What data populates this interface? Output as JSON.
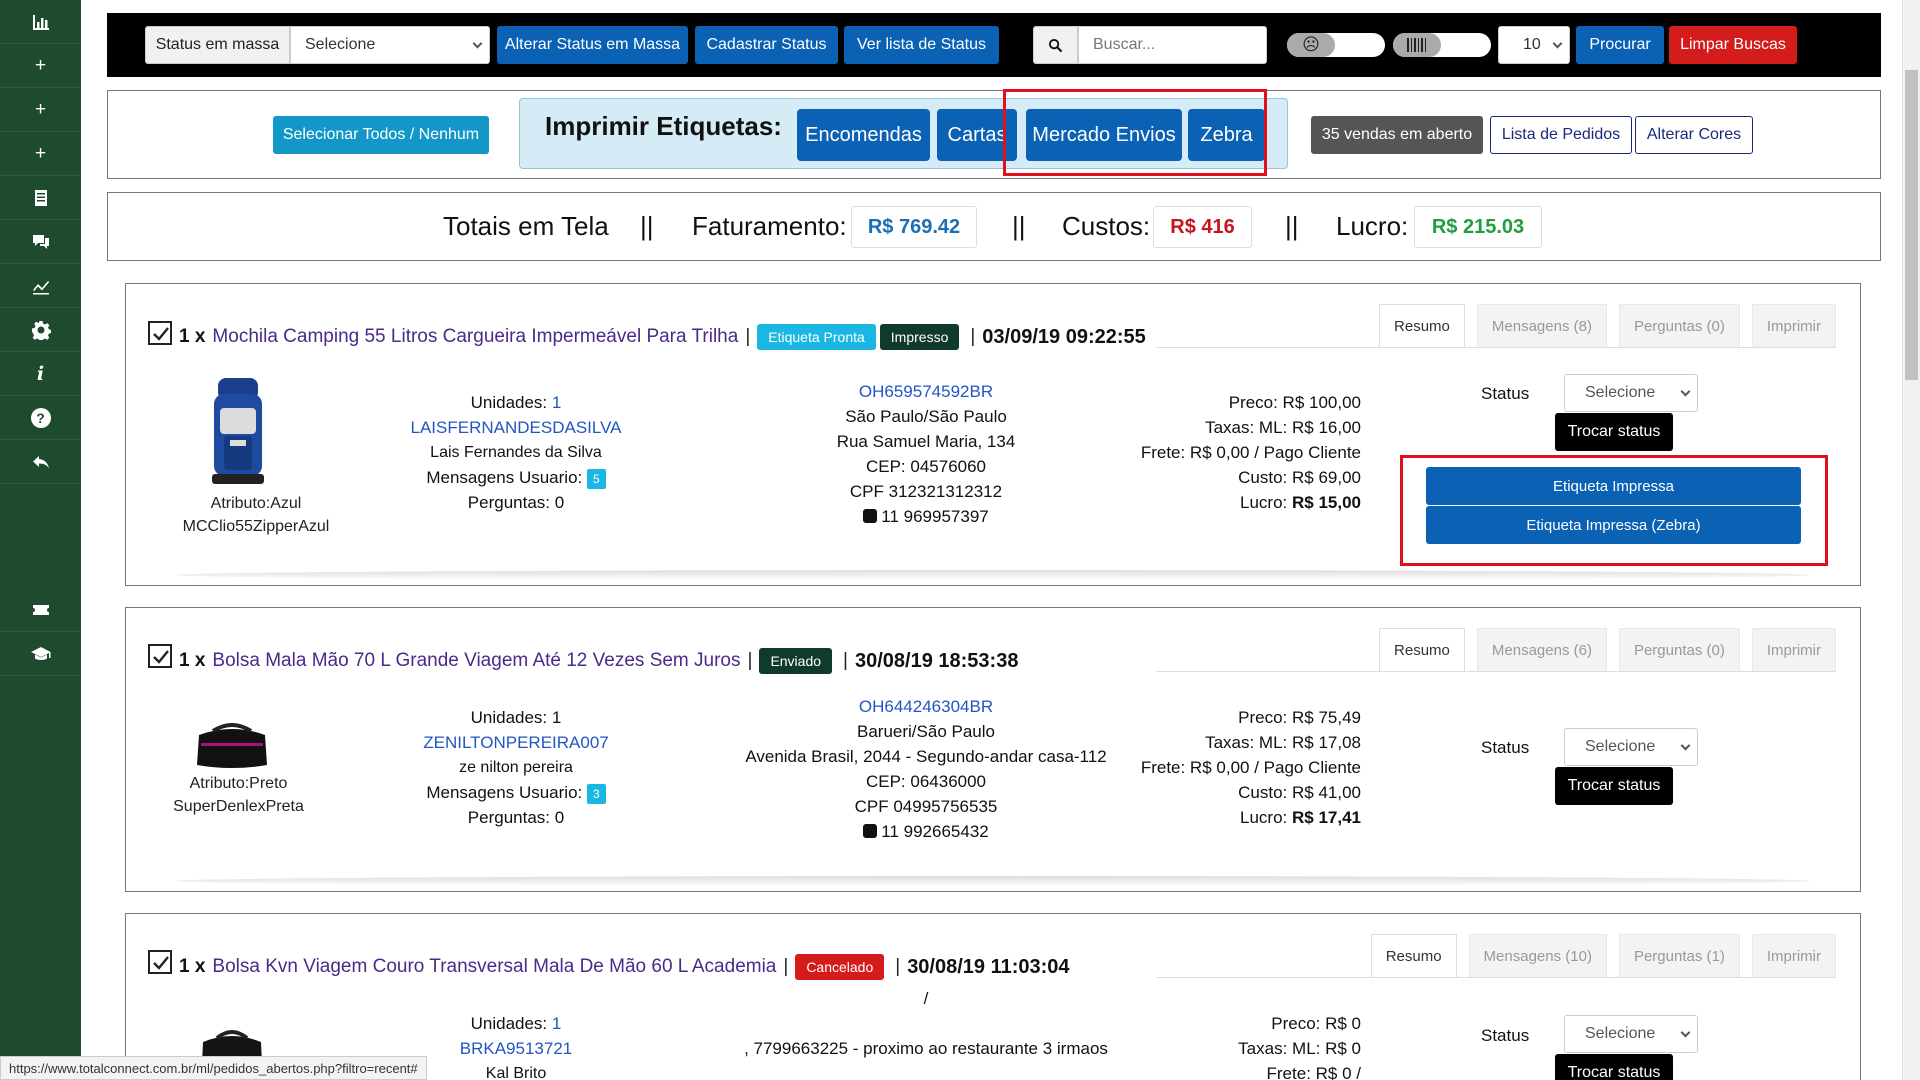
{
  "sidebar": {
    "items": [
      {
        "icon": "bar-chart-icon"
      },
      {
        "icon": "plus-icon",
        "glyph": "+"
      },
      {
        "icon": "plus-icon",
        "glyph": "+"
      },
      {
        "icon": "plus-icon",
        "glyph": "+"
      },
      {
        "icon": "document-icon"
      },
      {
        "icon": "comments-icon"
      },
      {
        "icon": "line-chart-icon"
      },
      {
        "icon": "gear-icon"
      },
      {
        "icon": "info-icon",
        "glyph": "i"
      },
      {
        "icon": "question-icon",
        "glyph": "?"
      },
      {
        "icon": "reply-icon"
      }
    ],
    "lower_items": [
      {
        "icon": "ticket-icon"
      },
      {
        "icon": "graduation-cap-icon"
      }
    ]
  },
  "toolbar": {
    "status_mass_label": "Status em massa",
    "select_value": "Selecione",
    "alter_status_mass": "Alterar Status em Massa",
    "register_status": "Cadastrar Status",
    "view_status_list": "Ver lista de Status",
    "search_placeholder": "Buscar...",
    "page_size": "10",
    "search_button": "Procurar",
    "clear_button": "Limpar Buscas"
  },
  "printbar": {
    "select_all": "Selecionar Todos / Nenhum",
    "print_labels_title": "Imprimir Etiquetas:",
    "print_buttons": [
      "Encomendas",
      "Cartas",
      "Mercado Envios",
      "Zebra"
    ],
    "open_sales": "35 vendas em aberto",
    "order_list": "Lista de Pedidos",
    "alter_colors": "Alterar Cores"
  },
  "totals": {
    "label": "Totais em Tela",
    "sep": "||",
    "revenue_label": "Faturamento:",
    "revenue_value": "R$ 769.42",
    "costs_label": "Custos:",
    "costs_value": "R$ 416",
    "profit_label": "Lucro:",
    "profit_value": "R$ 215.03"
  },
  "colors": {
    "sidebar": "#1e4a2e",
    "primary": "#0b61b3",
    "danger": "#d41c1c",
    "revenue": "#1a6fb5",
    "cost": "#c4161c",
    "profit": "#1e9e3e",
    "highlight": "#e0101c"
  },
  "tabs": {
    "summary": "Resumo",
    "print": "Imprimir"
  },
  "orders": [
    {
      "qty": "1 x",
      "product": "Mochila Camping 55 Litros Cargueira Impermeável Para Trilha",
      "badges": [
        "Etiqueta Pronta",
        "Impresso"
      ],
      "date": "03/09/19 09:22:55",
      "tab_messages": "Mensagens (8)",
      "tab_questions": "Perguntas (0)",
      "attr1": "Atributo:Azul",
      "attr2": "MCClio55ZipperAzul",
      "units_label": "Unidades:",
      "units": "1",
      "buyer_nick": "LAISFERNANDESDASILVA",
      "buyer_name": "Lais Fernandes da Silva",
      "messages_label": "Mensagens Usuario:",
      "messages_count": "5",
      "questions_label": "Perguntas: 0",
      "tracking": "OH659574592BR",
      "city": "São Paulo/São Paulo",
      "street": "Rua Samuel Maria, 134",
      "cep": "CEP: 04576060",
      "cpf": "CPF 312321312312",
      "phone": "11 969957397",
      "price": "Preco: R$ 100,00",
      "fees": "Taxas: ML: R$ 16,00",
      "shipping": "Frete: R$ 0,00 / Pago Cliente",
      "cost": "Custo: R$ 69,00",
      "profit_label": "Lucro:",
      "profit": "R$ 15,00",
      "status_label": "Status",
      "status_value": "Selecione",
      "change_status": "Trocar status",
      "label_printed": "Etiqueta Impressa",
      "label_printed_zebra": "Etiqueta Impressa (Zebra)"
    },
    {
      "qty": "1 x",
      "product": "Bolsa Mala Mão 70 L Grande Viagem Até 12 Vezes Sem Juros",
      "badges": [
        "Enviado"
      ],
      "date": "30/08/19 18:53:38",
      "tab_messages": "Mensagens (6)",
      "tab_questions": "Perguntas (0)",
      "attr1": "Atributo:Preto",
      "attr2": "SuperDenlexPreta",
      "units_label": "Unidades:",
      "units": "1",
      "buyer_nick": "ZENILTONPEREIRA007",
      "buyer_name": "ze nilton pereira",
      "messages_label": "Mensagens Usuario:",
      "messages_count": "3",
      "questions_label": "Perguntas: 0",
      "tracking": "OH644246304BR",
      "city": "Barueri/São Paulo",
      "street": "Avenida Brasil, 2044 - Segundo-andar casa-112",
      "cep": "CEP: 06436000",
      "cpf": "CPF 04995756535",
      "phone": "11 992665432",
      "price": "Preco: R$ 75,49",
      "fees": "Taxas: ML: R$ 17,08",
      "shipping": "Frete: R$ 0,00 / Pago Cliente",
      "cost": "Custo: R$ 41,00",
      "profit_label": "Lucro:",
      "profit": "R$ 17,41",
      "status_label": "Status",
      "status_value": "Selecione",
      "change_status": "Trocar status"
    },
    {
      "qty": "1 x",
      "product": "Bolsa Kvn Viagem Couro Transversal Mala De Mão 60 L Academia",
      "badges": [
        "Cancelado"
      ],
      "date": "30/08/19 11:03:04",
      "tab_messages": "Mensagens (10)",
      "tab_questions": "Perguntas (1)",
      "units_label": "Unidades:",
      "units": "1",
      "buyer_nick": "BRKA9513721",
      "buyer_name": "Kal Brito",
      "tracking_line": "/",
      "address": ", 7799663225 - proximo ao restaurante 3 irmaos",
      "price": "Preco: R$ 0",
      "fees": "Taxas: ML: R$ 0",
      "shipping": "Frete: R$ 0 /",
      "status_label": "Status",
      "status_value": "Selecione",
      "change_status": "Trocar status"
    }
  ],
  "status_url": "https://www.totalconnect.com.br/ml/pedidos_abertos.php?filtro=recent#"
}
